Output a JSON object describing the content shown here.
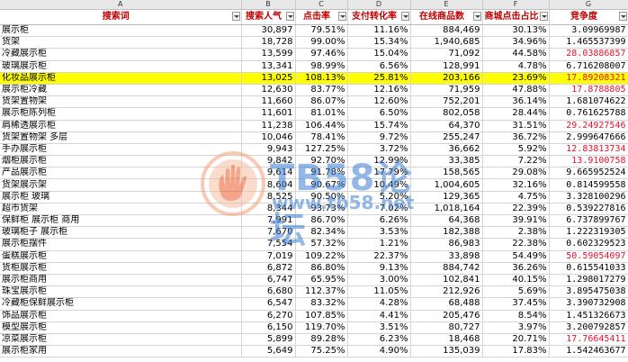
{
  "column_letters": [
    "A",
    "B",
    "C",
    "D",
    "E",
    "F",
    "G"
  ],
  "headers": [
    "搜索词",
    "搜索人气",
    "点击率",
    "支付转化率",
    "在线商品数",
    "商城点击占比",
    "竞争度"
  ],
  "rows": [
    {
      "kw": "展示柜",
      "pop": "30,897",
      "ctr": "79.51%",
      "cvr": "11.16%",
      "items": "884,469",
      "mall": "30.13%",
      "comp": "3.09969987",
      "red": false
    },
    {
      "kw": "货架",
      "pop": "18,728",
      "ctr": "99.00%",
      "cvr": "15.34%",
      "items": "1,940,685",
      "mall": "34.96%",
      "comp": "1.465537399",
      "red": false
    },
    {
      "kw": "冷藏展示柜",
      "pop": "13,599",
      "ctr": "97.46%",
      "cvr": "15.04%",
      "items": "71,092",
      "mall": "44.58%",
      "comp": "28.03886857",
      "red": true
    },
    {
      "kw": "玻璃展示柜",
      "pop": "13,341",
      "ctr": "98.99%",
      "cvr": "6.56%",
      "items": "128,991",
      "mall": "4.78%",
      "comp": "6.716208007",
      "red": false
    },
    {
      "kw": "化妆品展示柜",
      "pop": "13,025",
      "ctr": "108.13%",
      "cvr": "25.81%",
      "items": "203,166",
      "mall": "23.69%",
      "comp": "17.89208321",
      "red": true,
      "hl": true
    },
    {
      "kw": "展示柜冷藏",
      "pop": "12,630",
      "ctr": "83.77%",
      "cvr": "12.16%",
      "items": "71,959",
      "mall": "47.88%",
      "comp": "17.8788805",
      "red": true
    },
    {
      "kw": "货架置物架",
      "pop": "11,660",
      "ctr": "86.07%",
      "cvr": "12.60%",
      "items": "752,201",
      "mall": "36.14%",
      "comp": "1.681074622",
      "red": false
    },
    {
      "kw": "展示柜陈列柜",
      "pop": "11,601",
      "ctr": "81.01%",
      "cvr": "6.50%",
      "items": "802,058",
      "mall": "28.44%",
      "comp": "0.761625788",
      "red": false
    },
    {
      "kw": "肩稀透展示柜",
      "pop": "11,238",
      "ctr": "106.44%",
      "cvr": "15.74%",
      "items": "64,370",
      "mall": "31.51%",
      "comp": "29.24927546",
      "red": true
    },
    {
      "kw": "货架置物架 多层",
      "pop": "10,046",
      "ctr": "78.41%",
      "cvr": "9.72%",
      "items": "255,247",
      "mall": "36.72%",
      "comp": "2.999647666",
      "red": false
    },
    {
      "kw": "手办展示柜",
      "pop": "9,943",
      "ctr": "127.25%",
      "cvr": "3.72%",
      "items": "36,662",
      "mall": "5.92%",
      "comp": "12.83813734",
      "red": true
    },
    {
      "kw": "烟柜展示柜",
      "pop": "9,842",
      "ctr": "92.70%",
      "cvr": "12.99%",
      "items": "33,385",
      "mall": "7.22%",
      "comp": "13.9100758",
      "red": true
    },
    {
      "kw": "产品展示柜",
      "pop": "9,614",
      "ctr": "91.78%",
      "cvr": "17.79%",
      "items": "158,565",
      "mall": "29.08%",
      "comp": "9.665952524",
      "red": false
    },
    {
      "kw": "货架展示架",
      "pop": "8,604",
      "ctr": "90.67%",
      "cvr": "10.49%",
      "items": "1,004,605",
      "mall": "32.16%",
      "comp": "0.814599558",
      "red": false
    },
    {
      "kw": "展示柜 玻璃",
      "pop": "8,525",
      "ctr": "90.50%",
      "cvr": "5.20%",
      "items": "129,365",
      "mall": "4.75%",
      "comp": "3.328100296",
      "red": false
    },
    {
      "kw": "超市货架",
      "pop": "8,344",
      "ctr": "93.73%",
      "cvr": "7.02%",
      "items": "1,018,164",
      "mall": "22.39%",
      "comp": "0.539227816",
      "red": false
    },
    {
      "kw": "保鲜柜 展示柜 商用",
      "pop": "7,991",
      "ctr": "86.70%",
      "cvr": "6.26%",
      "items": "64,368",
      "mall": "39.91%",
      "comp": "6.737899767",
      "red": false
    },
    {
      "kw": "玻璃柜子 展示柜",
      "pop": "7,670",
      "ctr": "82.34%",
      "cvr": "3.53%",
      "items": "182,388",
      "mall": "2.38%",
      "comp": "1.222319305",
      "red": false
    },
    {
      "kw": "展示柜摆件",
      "pop": "7,554",
      "ctr": "57.32%",
      "cvr": "1.21%",
      "items": "86,983",
      "mall": "22.38%",
      "comp": "0.602329523",
      "red": false
    },
    {
      "kw": "蛋糕展示柜",
      "pop": "7,019",
      "ctr": "109.22%",
      "cvr": "22.37%",
      "items": "33,898",
      "mall": "54.49%",
      "comp": "50.59054097",
      "red": true
    },
    {
      "kw": "货柜展示柜",
      "pop": "6,872",
      "ctr": "86.80%",
      "cvr": "9.13%",
      "items": "884,742",
      "mall": "36.26%",
      "comp": "0.615541033",
      "red": false
    },
    {
      "kw": "展示柜商用",
      "pop": "6,747",
      "ctr": "65.95%",
      "cvr": "3.00%",
      "items": "102,841",
      "mall": "40.15%",
      "comp": "1.298017279",
      "red": false
    },
    {
      "kw": "珠宝展示柜",
      "pop": "6,680",
      "ctr": "112.37%",
      "cvr": "11.05%",
      "items": "212,926",
      "mall": "5.69%",
      "comp": "3.895475038",
      "red": false
    },
    {
      "kw": "冷藏柜保鲜展示柜",
      "pop": "6,547",
      "ctr": "83.32%",
      "cvr": "4.28%",
      "items": "68,488",
      "mall": "37.45%",
      "comp": "3.390732908",
      "red": false
    },
    {
      "kw": "饰品展示柜",
      "pop": "6,270",
      "ctr": "107.85%",
      "cvr": "4.41%",
      "items": "205,476",
      "mall": "8.54%",
      "comp": "1.451326673",
      "red": false
    },
    {
      "kw": "模型展示柜",
      "pop": "6,150",
      "ctr": "119.70%",
      "cvr": "3.51%",
      "items": "80,727",
      "mall": "3.97%",
      "comp": "3.200792857",
      "red": false
    },
    {
      "kw": "凉菜展示柜",
      "pop": "5,899",
      "ctr": "89.28%",
      "cvr": "6.23%",
      "items": "18,468",
      "mall": "20.71%",
      "comp": "17.76645411",
      "red": true
    },
    {
      "kw": "展示柜家用",
      "pop": "5,649",
      "ctr": "75.25%",
      "cvr": "4.90%",
      "items": "135,039",
      "mall": "17.83%",
      "comp": "1.542463677",
      "red": false
    }
  ],
  "watermark": {
    "name": "TB58论坛",
    "url": "www.tb58.net"
  },
  "colors": {
    "header_text": "#c00000",
    "highlight_row": "#ffff00",
    "red_value": "#e8112d",
    "watermark": "#3b7fd4"
  }
}
